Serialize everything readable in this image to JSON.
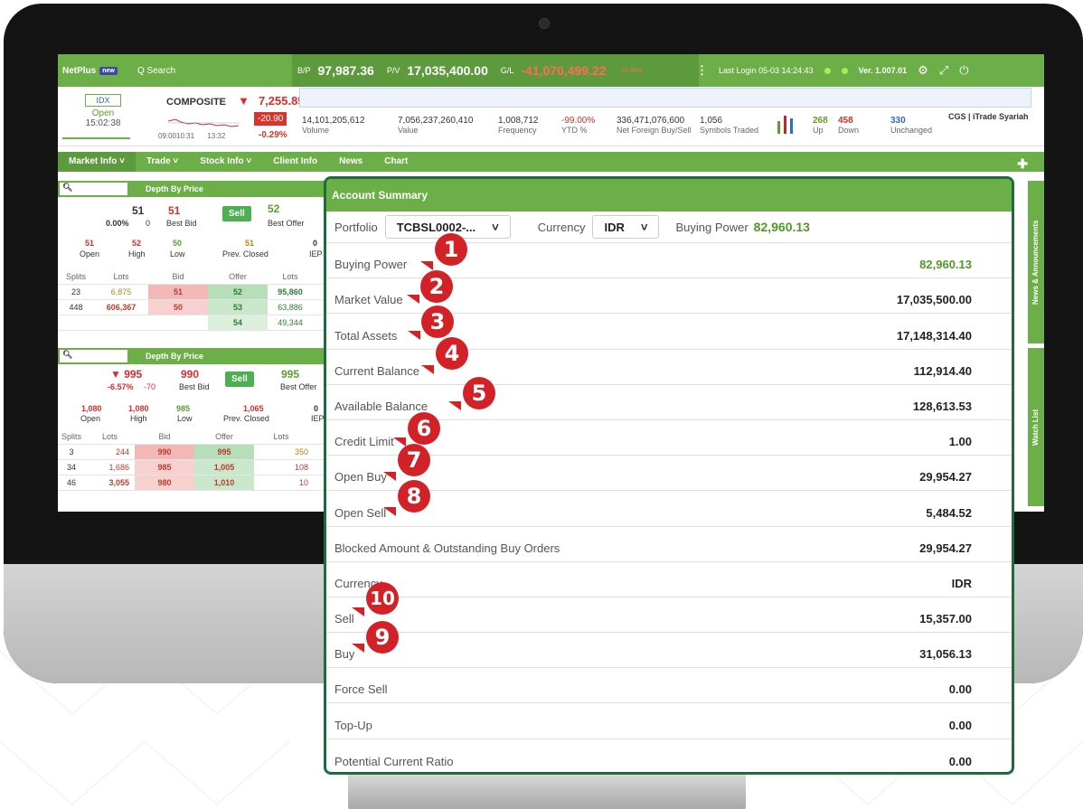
{
  "topbar": {
    "brand": "NetPlus",
    "new_badge": "new",
    "search": "Q Search",
    "bp_label": "B/P",
    "bp_value": "97,987.36",
    "pv_label": "P/V",
    "pv_value": "17,035,400.00",
    "gl_label": "G/L",
    "gl_value": "-41,070,499.22",
    "gl_pct": "-70.68%",
    "last_login": "Last Login  05-03 14:24:43",
    "version": "Ver. 1.007.01",
    "icons": [
      "more-vertical-icon",
      "gear-icon",
      "expand-icon",
      "power-icon"
    ]
  },
  "index": {
    "code": "IDX",
    "status": "Open",
    "time": "15:02:38",
    "name": "COMPOSITE",
    "value": "7,255.85",
    "change": "-20.90",
    "change_pct": "-0.29%",
    "time_start": "09:00",
    "time_mid": "10:31",
    "time_end": "13:32",
    "stats": [
      {
        "value": "14,101,205,612",
        "label": "Volume"
      },
      {
        "value": "7,056,237,260,410",
        "label": "Value"
      },
      {
        "value": "1,008,712",
        "label": "Frequency"
      },
      {
        "value": "-99.00%",
        "label": "YTD %"
      },
      {
        "value": "336,471,076,600",
        "label": "Net Foreign Buy/Sell"
      },
      {
        "value": "1,056",
        "label": "Symbols Traded"
      },
      {
        "value": "268",
        "label": "Up"
      },
      {
        "value": "458",
        "label": "Down"
      },
      {
        "value": "330",
        "label": "Unchanged"
      }
    ],
    "brand": "CGS | iTrade Syariah"
  },
  "menu": [
    "Market Info ˅",
    "Trade ˅",
    "Stock Info ˅",
    "Client Info",
    "News",
    "Chart"
  ],
  "depth1": {
    "title": "Depth By Price",
    "last": "51",
    "pct": "0.00%",
    "chg": "0",
    "best_bid": "51",
    "best_bid_label": "Best Bid",
    "sell_label": "Sell",
    "best_offer": "52",
    "best_offer_label": "Best Offer",
    "stats": [
      [
        "51",
        "Open"
      ],
      [
        "52",
        "High"
      ],
      [
        "50",
        "Low"
      ],
      [
        "51",
        "Prev. Closed"
      ],
      [
        "0",
        "IEP"
      ]
    ],
    "headers": [
      "Splits",
      "Lots",
      "Bid",
      "Offer",
      "Lots"
    ],
    "rows": [
      [
        "23",
        "6,875",
        "51",
        "52",
        "95,860"
      ],
      [
        "448",
        "606,367",
        "50",
        "53",
        "63,886"
      ],
      [
        "",
        "",
        "",
        "54",
        "49,344"
      ]
    ]
  },
  "depth2": {
    "title": "Depth By Price",
    "last": "▼ 995",
    "pct": "-6.57%",
    "chg": "-70",
    "best_bid": "990",
    "best_bid_label": "Best Bid",
    "sell_label": "Sell",
    "best_offer": "995",
    "best_offer_label": "Best Offer",
    "stats": [
      [
        "1,080",
        "Open"
      ],
      [
        "1,080",
        "High"
      ],
      [
        "985",
        "Low"
      ],
      [
        "1,065",
        "Prev. Closed"
      ],
      [
        "0",
        "IEP"
      ]
    ],
    "headers": [
      "Splits",
      "Lots",
      "Bid",
      "Offer",
      "Lots"
    ],
    "rows": [
      [
        "3",
        "244",
        "990",
        "995",
        "350"
      ],
      [
        "34",
        "1,686",
        "985",
        "1,005",
        "108"
      ],
      [
        "46",
        "3,055",
        "980",
        "1,010",
        "10"
      ]
    ]
  },
  "sidetabs": [
    "News & Announcements",
    "Watch List"
  ],
  "account": {
    "title": "Account Summary",
    "portfolio_label": "Portfolio",
    "portfolio_value": "TCBSL0002-...",
    "currency_label": "Currency",
    "currency_value": "IDR",
    "bp_label": "Buying Power",
    "bp_value": "82,960.13",
    "rows": [
      {
        "label": "Buying Power",
        "value": "82,960.13"
      },
      {
        "label": "Market Value",
        "value": "17,035,500.00"
      },
      {
        "label": "Total Assets",
        "value": "17,148,314.40"
      },
      {
        "label": "Current Balance",
        "value": "112,914.40"
      },
      {
        "label": "Available Balance",
        "value": "128,613.53"
      },
      {
        "label": "Credit Limit",
        "value": "1.00"
      },
      {
        "label": "Open Buy",
        "value": "29,954.27"
      },
      {
        "label": "Open Sell",
        "value": "5,484.52"
      },
      {
        "label": "Blocked Amount & Outstanding Buy Orders",
        "value": "29,954.27"
      },
      {
        "label": "Currency",
        "value": "IDR"
      },
      {
        "label": "Sell",
        "value": "15,357.00"
      },
      {
        "label": "Buy",
        "value": "31,056.13"
      },
      {
        "label": "Force Sell",
        "value": "0.00"
      },
      {
        "label": "Top-Up",
        "value": "0.00"
      },
      {
        "label": "Potential Current Ratio",
        "value": "0.00"
      }
    ]
  },
  "callouts": [
    "1",
    "2",
    "3",
    "4",
    "5",
    "6",
    "7",
    "8",
    "10",
    "9"
  ],
  "colors": {
    "brand_green": "#6cae48",
    "frame_green": "#1c6d3a",
    "callout_red": "#d32128",
    "positive": "#5a9e2c",
    "negative": "#e02a2a"
  }
}
